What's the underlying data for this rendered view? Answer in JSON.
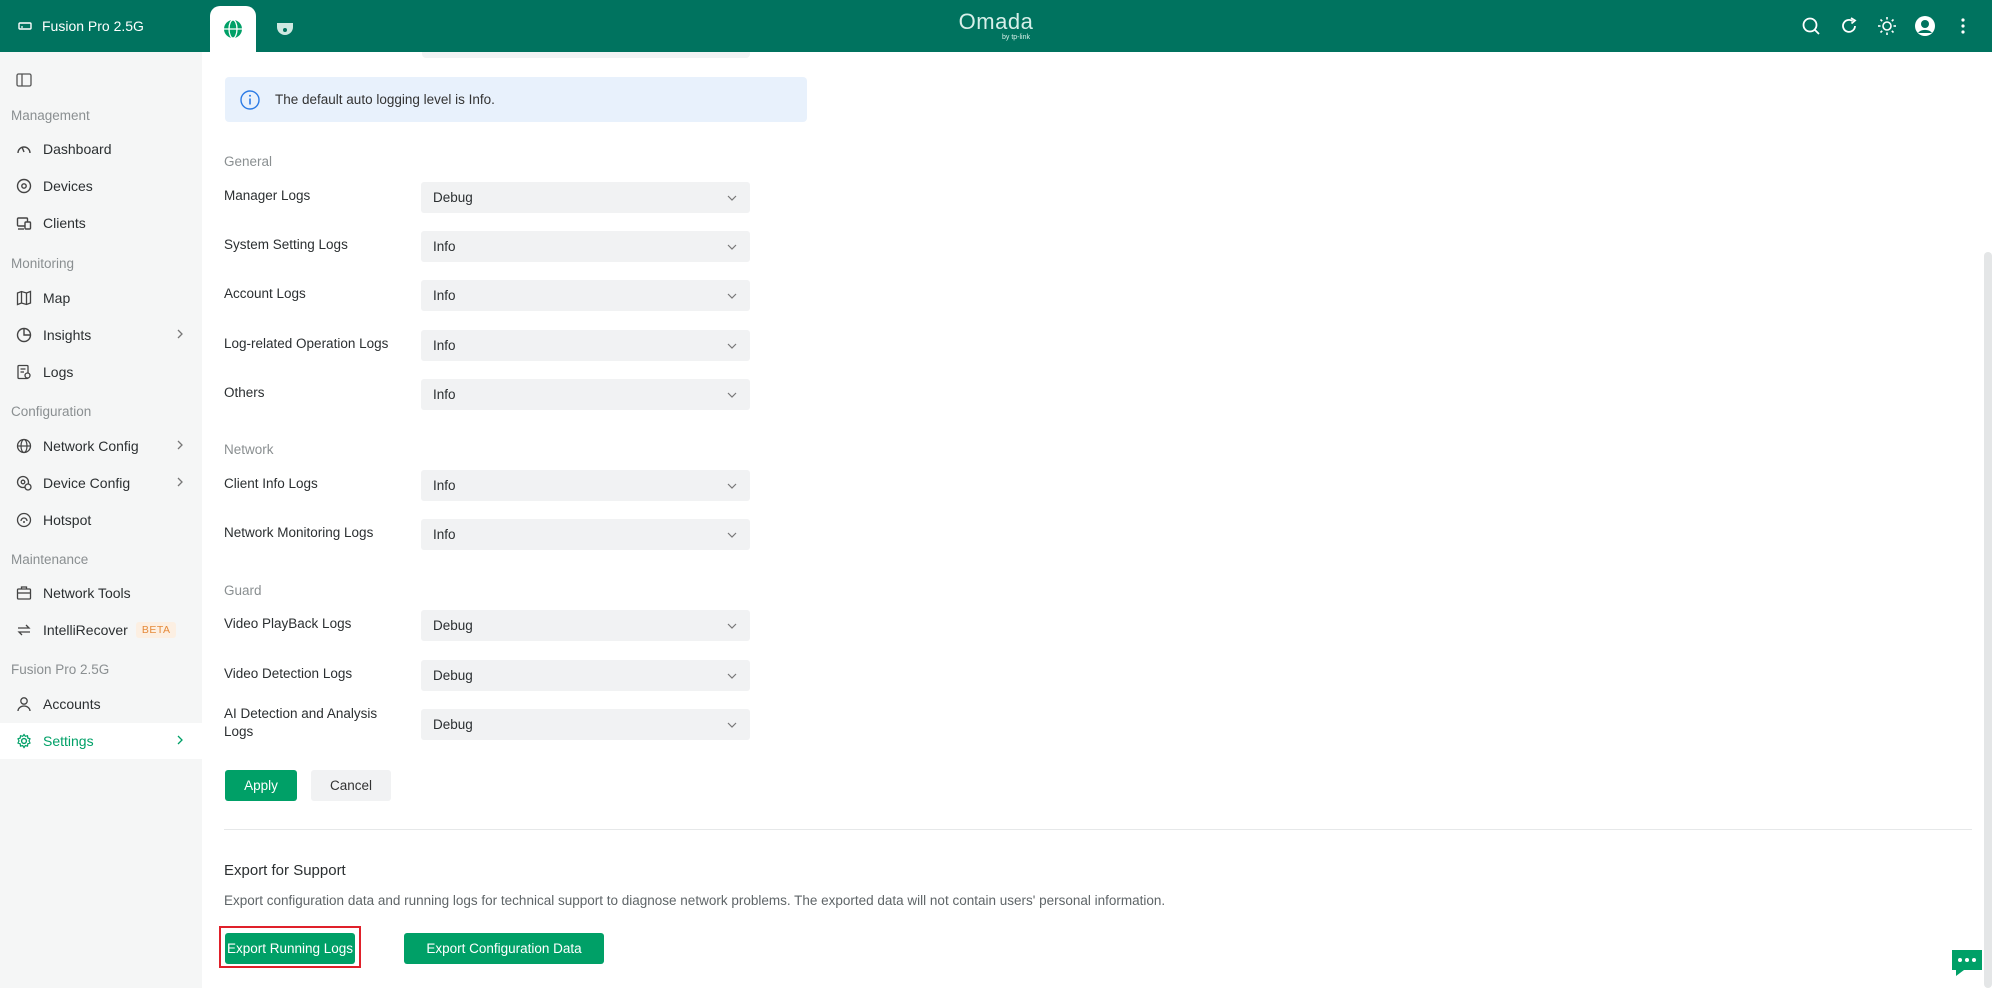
{
  "header": {
    "device_name": "Fusion Pro 2.5G",
    "logo_text": "Omada",
    "logo_sub": "by tp-link",
    "tabs": [
      {
        "icon": "globe-icon",
        "active": true
      },
      {
        "icon": "camera-icon",
        "active": false
      }
    ],
    "icons": [
      "search-icon",
      "refresh-icon",
      "theme-sun-icon",
      "avatar-icon",
      "more-vertical-icon"
    ]
  },
  "sidebar": {
    "sections": {
      "management": "Management",
      "monitoring": "Monitoring",
      "configuration": "Configuration",
      "maintenance": "Maintenance",
      "device": "Fusion Pro 2.5G"
    },
    "items": {
      "dashboard": "Dashboard",
      "devices": "Devices",
      "clients": "Clients",
      "map": "Map",
      "insights": "Insights",
      "logs": "Logs",
      "network_config": "Network Config",
      "device_config": "Device Config",
      "hotspot": "Hotspot",
      "network_tools": "Network Tools",
      "intellirecover": "IntelliRecover",
      "intellirecover_badge": "BETA",
      "accounts": "Accounts",
      "settings": "Settings"
    },
    "active": "settings"
  },
  "main": {
    "info_text": "The default auto logging level is Info.",
    "groups": {
      "general": "General",
      "network": "Network",
      "guard": "Guard"
    },
    "rows": {
      "manager_logs": {
        "label": "Manager Logs",
        "value": "Debug"
      },
      "system_setting_logs": {
        "label": "System Setting Logs",
        "value": "Info"
      },
      "account_logs": {
        "label": "Account Logs",
        "value": "Info"
      },
      "log_related_operation_logs": {
        "label": "Log-related Operation Logs",
        "value": "Info"
      },
      "others": {
        "label": "Others",
        "value": "Info"
      },
      "client_info_logs": {
        "label": "Client Info Logs",
        "value": "Info"
      },
      "network_monitoring_logs": {
        "label": "Network Monitoring Logs",
        "value": "Info"
      },
      "video_playback_logs": {
        "label": "Video PlayBack Logs",
        "value": "Debug"
      },
      "video_detection_logs": {
        "label": "Video Detection Logs",
        "value": "Debug"
      },
      "ai_detection_logs": {
        "label": "AI Detection and Analysis Logs",
        "value": "Debug"
      }
    },
    "apply_label": "Apply",
    "cancel_label": "Cancel",
    "export": {
      "title": "Export for Support",
      "description": "Export configuration data and running logs for technical support to diagnose network problems. The exported data will not contain users' personal information.",
      "running_logs_label": "Export Running Logs",
      "config_data_label": "Export Configuration Data"
    }
  },
  "colors": {
    "header_bg": "#00735f",
    "accent": "#00a067",
    "highlight_border": "#e0202a",
    "info_bg": "#e8f1fc"
  }
}
